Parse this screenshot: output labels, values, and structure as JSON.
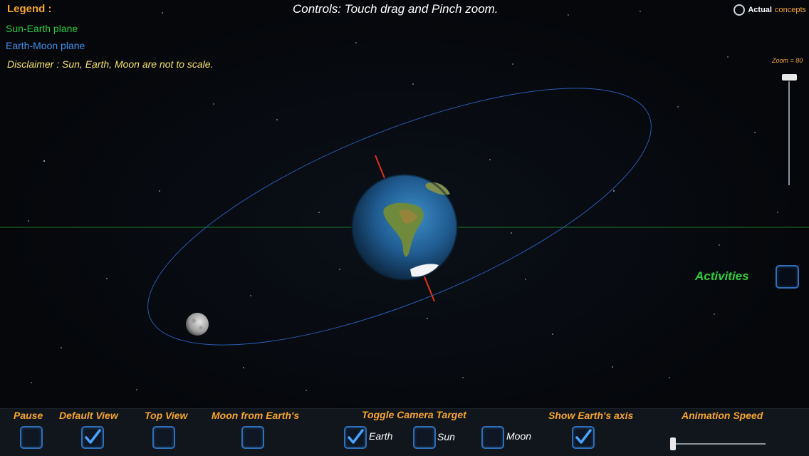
{
  "legend": {
    "title": "Legend :",
    "items": [
      {
        "label": "Sun-Earth plane",
        "color": "#27c93f"
      },
      {
        "label": "Earth-Moon plane",
        "color": "#3d8fe8"
      }
    ],
    "disclaimer": "Disclaimer : Sun, Earth, Moon are not  to  scale."
  },
  "controls_hint": "Controls: Touch drag and Pinch zoom.",
  "brand": {
    "bold": "Actual",
    "rest": "concepts"
  },
  "zoom": {
    "label": "Zoom = 80",
    "value": 80
  },
  "activities": {
    "label": "Activities",
    "checked": false
  },
  "bottom": {
    "pause": {
      "label": "Pause",
      "checked": false
    },
    "default_view": {
      "label": "Default View",
      "checked": true
    },
    "top_view": {
      "label": "Top View",
      "checked": false
    },
    "moon_view": {
      "label": "Moon from Earth's",
      "checked": false
    },
    "camera_target": {
      "label": "Toggle Camera Target",
      "options": [
        {
          "label": "Earth",
          "checked": true
        },
        {
          "label": "Sun",
          "checked": false
        },
        {
          "label": "Moon",
          "checked": false
        }
      ]
    },
    "show_axis": {
      "label": "Show Earth's axis",
      "checked": true
    },
    "animation_speed": {
      "label": "Animation Speed"
    }
  },
  "colors": {
    "accent": "#f5a52a",
    "disclaimer": "#f2e06a",
    "activities": "#2fd13a",
    "checkbox_border": "#2d6fb8",
    "check": "#4aa3ff",
    "axis": "#e0321c",
    "orbit": "#2a5bb0",
    "plane": "#1e7a24"
  }
}
